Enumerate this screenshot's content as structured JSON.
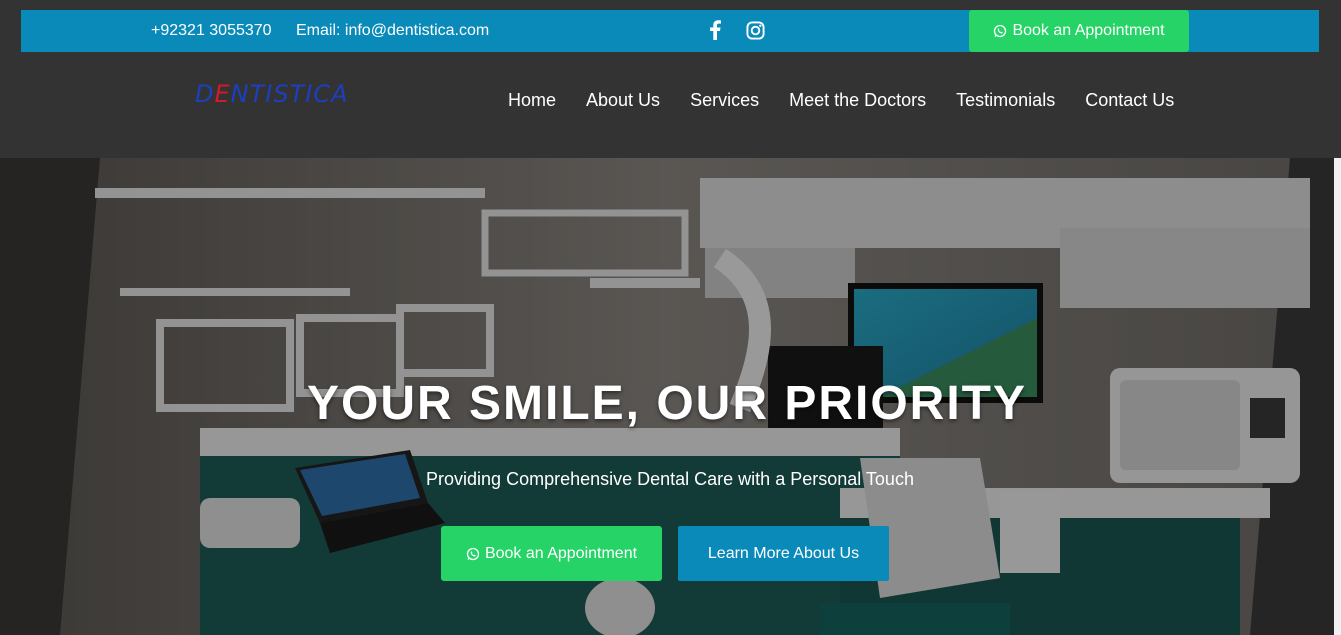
{
  "topbar": {
    "phone": "+92321 3055370",
    "email": "Email: info@dentistica.com",
    "social": [
      "facebook-icon",
      "instagram-icon"
    ],
    "book_label": "Book an Appointment"
  },
  "brand": {
    "logo_prefix": "D",
    "logo_e": "E",
    "logo_rest": "NTISTICA"
  },
  "nav": {
    "items": [
      {
        "label": "Home"
      },
      {
        "label": "About Us"
      },
      {
        "label": "Services"
      },
      {
        "label": "Meet the Doctors"
      },
      {
        "label": "Testimonials"
      },
      {
        "label": "Contact Us"
      }
    ]
  },
  "hero": {
    "title": "YOUR SMILE, OUR PRIORITY",
    "subtitle": "Providing Comprehensive Dental Care with a Personal Touch",
    "book_label": "Book an Appointment",
    "learn_label": "Learn More About Us"
  },
  "colors": {
    "topbar": "#0a8ab8",
    "whatsapp_green": "#25d366",
    "nav_bg": "#333333",
    "logo_blue": "#1b3fbf",
    "logo_red": "#d11a2a"
  }
}
